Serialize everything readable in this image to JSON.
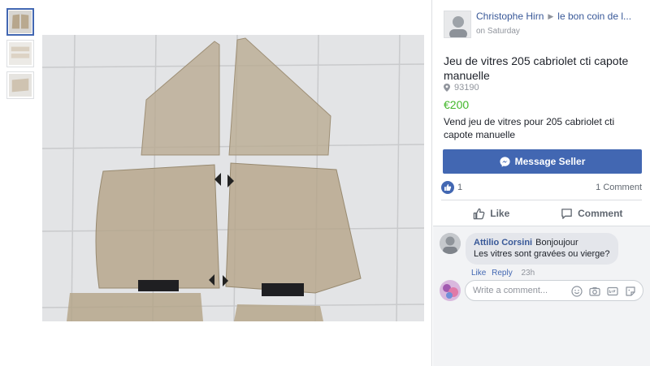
{
  "seller": {
    "name": "Christophe Hirn",
    "group": "le bon coin de l...",
    "posted": "on Saturday"
  },
  "listing": {
    "title": "Jeu de vitres 205 cabriolet cti capote manuelle",
    "location": "93190",
    "price": "€200",
    "description": "Vend jeu de vitres pour 205 cabriolet cti capote manuelle"
  },
  "actions": {
    "message_seller": "Message Seller",
    "like": "Like",
    "comment": "Comment"
  },
  "reactions": {
    "like_count": "1",
    "comment_count": "1 Comment"
  },
  "comment": {
    "author": "Attilio Corsini",
    "line1": "Bonjoujour",
    "line2": "Les vitres sont gravées ou vierge?",
    "like": "Like",
    "reply": "Reply",
    "time": "23h"
  },
  "composer": {
    "placeholder": "Write a comment..."
  },
  "icons": {
    "messenger": "messenger-icon",
    "thumbs_up": "thumbs-up-icon",
    "speech_bubble": "comment-icon",
    "pin": "location-pin-icon",
    "emoji": "emoji-icon",
    "camera": "camera-icon",
    "gif": "gif-icon",
    "sticker": "sticker-icon"
  },
  "colors": {
    "brand": "#4267b2",
    "price": "#42b72a",
    "link": "#385898"
  }
}
